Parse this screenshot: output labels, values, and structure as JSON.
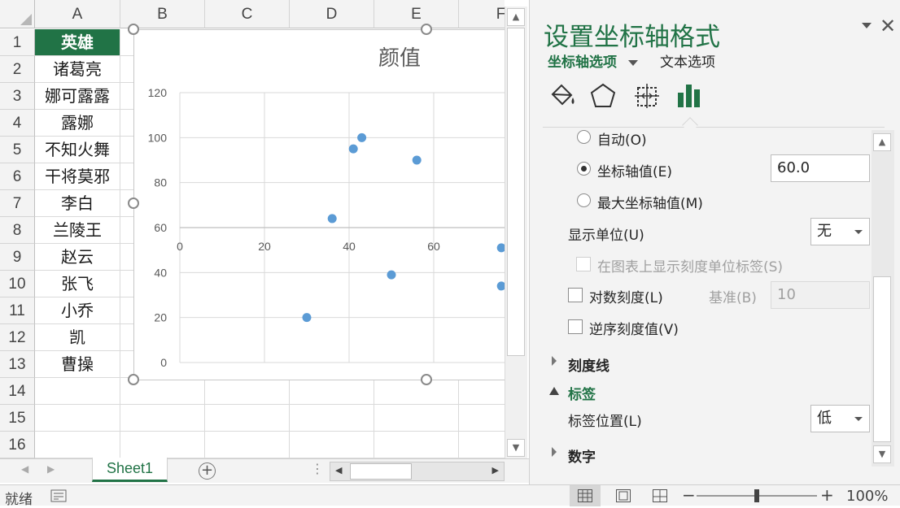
{
  "sheet": {
    "columns": [
      "A",
      "B",
      "C",
      "D",
      "E",
      "F"
    ],
    "rows": [
      "1",
      "2",
      "3",
      "4",
      "5",
      "6",
      "7",
      "8",
      "9",
      "10",
      "11",
      "12",
      "13",
      "14",
      "15",
      "16"
    ],
    "column_a": [
      "英雄",
      "诸葛亮",
      "娜可露露",
      "露娜",
      "不知火舞",
      "干将莫邪",
      "李白",
      "兰陵王",
      "赵云",
      "张飞",
      "小乔",
      "凯",
      "曹操"
    ],
    "tab_name": "Sheet1",
    "add_sheet_symbol": "+"
  },
  "chart_data": {
    "type": "scatter",
    "title": "颜值",
    "x_ticks": [
      "0",
      "20",
      "40",
      "60"
    ],
    "y_ticks": [
      "0",
      "20",
      "40",
      "60",
      "80",
      "100",
      "120"
    ],
    "xlim": [
      0,
      76
    ],
    "ylim": [
      0,
      120
    ],
    "x_axis_crosses_at": 60,
    "grid": true,
    "points": [
      {
        "x": 30,
        "y": 20
      },
      {
        "x": 36,
        "y": 64
      },
      {
        "x": 41,
        "y": 95
      },
      {
        "x": 43,
        "y": 100
      },
      {
        "x": 50,
        "y": 39
      },
      {
        "x": 56,
        "y": 90
      },
      {
        "x": 76,
        "y": 51
      },
      {
        "x": 76,
        "y": 34
      }
    ],
    "point_color": "#5b9bd5"
  },
  "pane": {
    "title": "设置坐标轴格式",
    "tab_axis_options": "坐标轴选项",
    "tab_text_options": "文本选项",
    "radio_auto": "自动(O)",
    "radio_axis_value": "坐标轴值(E)",
    "axis_value": "60.0",
    "radio_max_axis_value": "最大坐标轴值(M)",
    "display_units_label": "显示单位(U)",
    "display_units_value": "无",
    "show_units_label_on_chart": "在图表上显示刻度单位标签(S)",
    "log_scale_label": "对数刻度(L)",
    "base_label": "基准(B)",
    "base_value": "10",
    "reverse_order_label": "逆序刻度值(V)",
    "section_tick_marks": "刻度线",
    "section_labels": "标签",
    "label_position_label": "标签位置(L)",
    "label_position_value": "低",
    "section_number": "数字",
    "accent_color": "#217346"
  },
  "status": {
    "ready": "就绪",
    "zoom_minus": "−",
    "zoom_plus": "+",
    "zoom": "100%"
  }
}
